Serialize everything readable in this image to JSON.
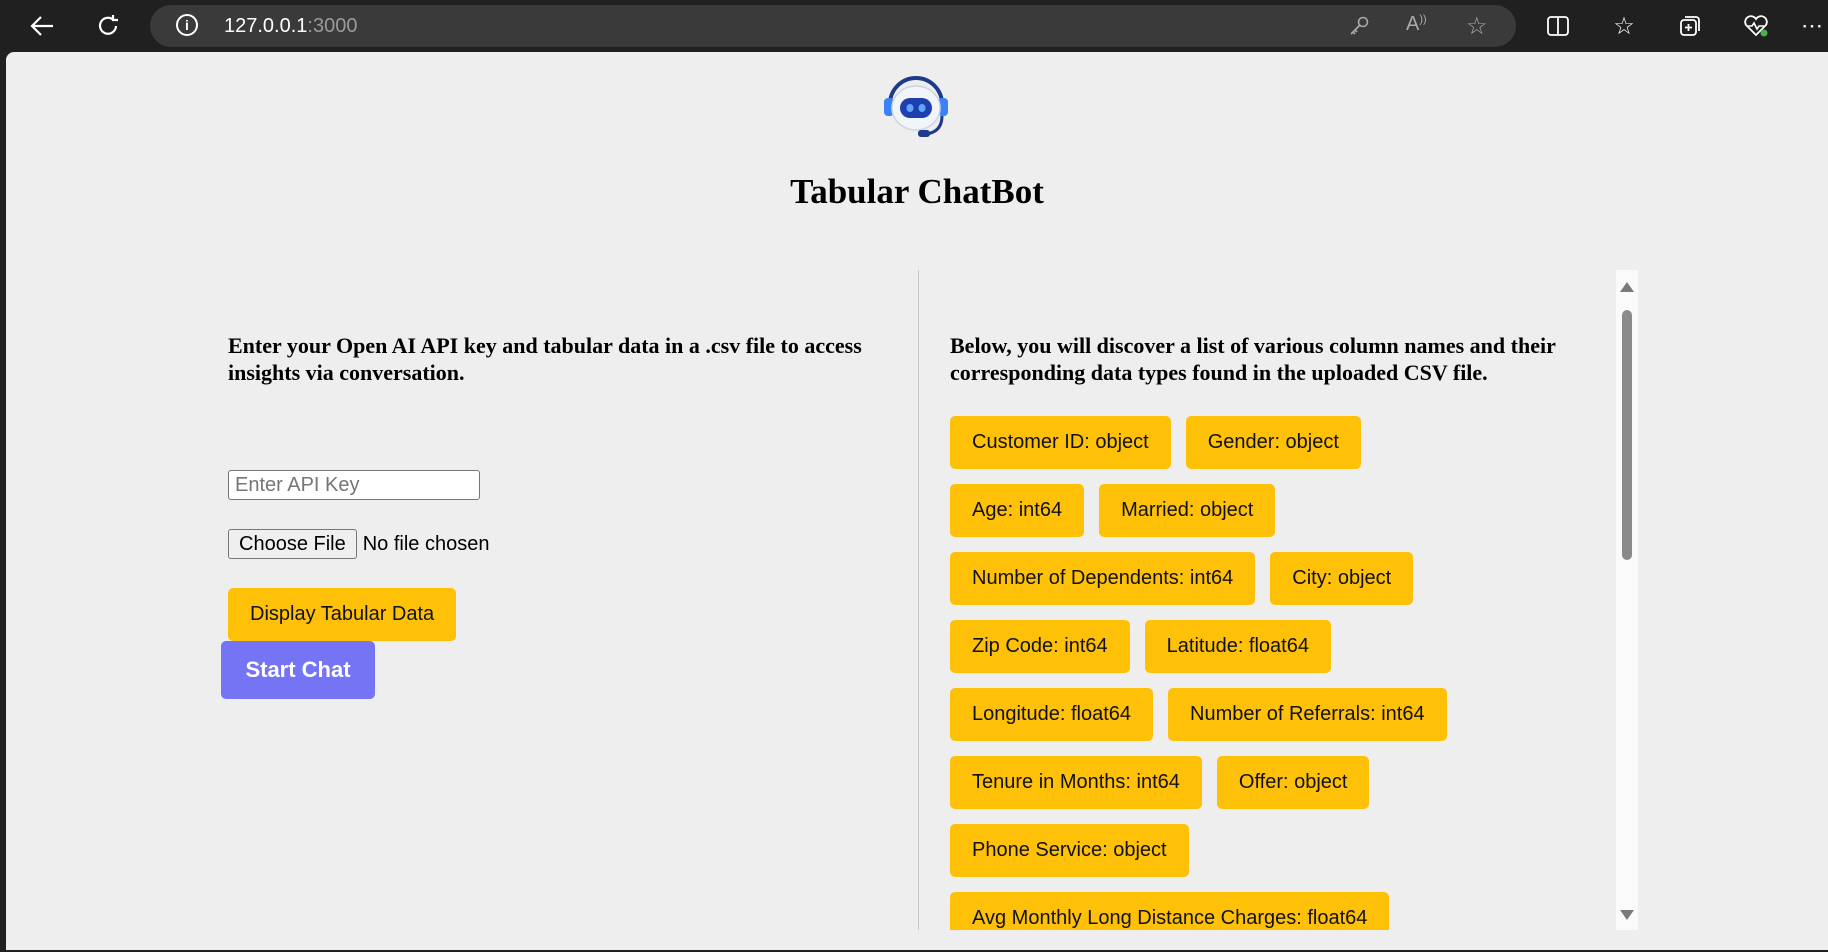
{
  "browser": {
    "url_host": "127.0.0.1",
    "url_port": ":3000",
    "icons": [
      "back-icon",
      "refresh-icon",
      "info-icon",
      "key-icon",
      "read-aloud-icon",
      "favorite-star-icon",
      "split-screen-icon",
      "favorites-icon",
      "collections-icon",
      "health-icon",
      "more-icon"
    ]
  },
  "header": {
    "title": "Tabular ChatBot"
  },
  "left_panel": {
    "instructions": "Enter your Open AI API key and tabular data in a .csv file to access insights via conversation.",
    "api_key_placeholder": "Enter API Key",
    "choose_file_label": "Choose File",
    "file_status": "No file chosen",
    "display_button": "Display Tabular Data",
    "start_chat_button": "Start Chat"
  },
  "right_panel": {
    "description": "Below, you will discover a list of various column names and their corresponding data types found in the uploaded CSV file.",
    "columns": [
      "Customer ID: object",
      "Gender: object",
      "Age: int64",
      "Married: object",
      "Number of Dependents: int64",
      "City: object",
      "Zip Code: int64",
      "Latitude: float64",
      "Longitude: float64",
      "Number of Referrals: int64",
      "Tenure in Months: int64",
      "Offer: object",
      "Phone Service: object",
      "Avg Monthly Long Distance Charges: float64"
    ]
  },
  "colors": {
    "accent_yellow": "#ffc107",
    "start_button": "#7474f5",
    "page_background": "#eeeeee"
  }
}
